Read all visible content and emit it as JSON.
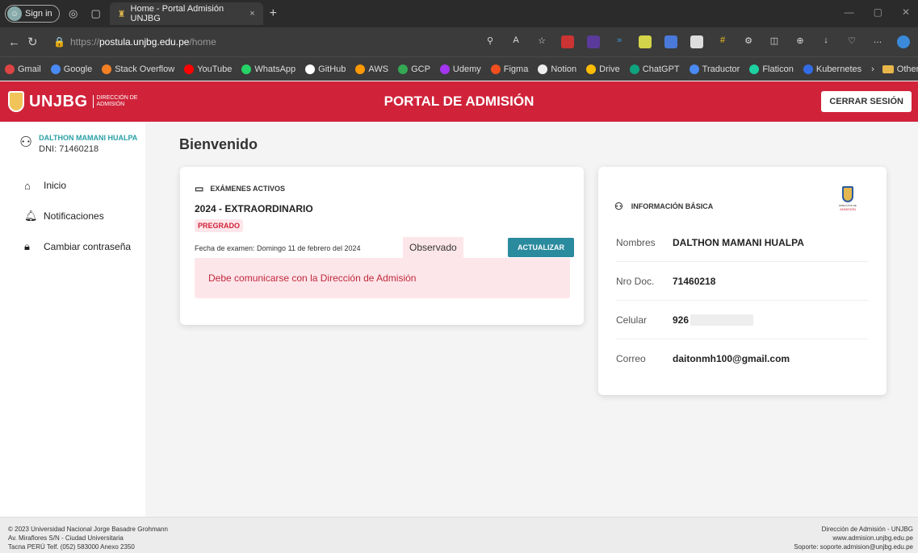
{
  "browser": {
    "signin": "Sign in",
    "tab_title": "Home - Portal Admisión UNJBG",
    "tab_close": "×",
    "new_tab": "+",
    "url_prefix": "https://",
    "url_host": "postula.unjbg.edu.pe",
    "url_path": "/home",
    "bookmarks": [
      "Gmail",
      "Google",
      "Stack Overflow",
      "YouTube",
      "WhatsApp",
      "GitHub",
      "AWS",
      "GCP",
      "Udemy",
      "Figma",
      "Notion",
      "Drive",
      "ChatGPT",
      "Traductor",
      "Flaticon",
      "Kubernetes"
    ],
    "other_favourites": "Other favourites"
  },
  "header": {
    "logo_name": "UNJBG",
    "logo_sub1": "DIRECCIÓN DE",
    "logo_sub2": "ADMISIÓN",
    "title": "PORTAL DE ADMISIÓN",
    "logout": "CERRAR SESIÓN"
  },
  "sidebar": {
    "user_name": "DALTHON MAMANI HUALPA",
    "dni": "DNI: 71460218",
    "items": [
      {
        "label": "Inicio",
        "icon": "home-icon"
      },
      {
        "label": "Notificaciones",
        "icon": "bell-icon"
      },
      {
        "label": "Cambiar contraseña",
        "icon": "lock-icon"
      }
    ]
  },
  "main": {
    "welcome": "Bienvenido",
    "exams": {
      "heading": "EXÁMENES ACTIVOS",
      "exam_name": "2024 - EXTRAORDINARIO",
      "level": "PREGRADO",
      "date": "Fecha de examen: Domingo 11 de febrero del 2024",
      "status": "Observado",
      "update": "ACTUALIZAR",
      "alert": "Debe comunicarse con la Dirección de Admisión"
    },
    "info": {
      "heading": "INFORMACIÓN BÁSICA",
      "logo_line1": "DIRECCIÓN DE",
      "logo_line2": "ADMISIÓN",
      "rows": [
        {
          "key": "Nombres",
          "value": "DALTHON MAMANI HUALPA"
        },
        {
          "key": "Nro Doc.",
          "value": "71460218"
        },
        {
          "key": "Celular",
          "value": "926"
        },
        {
          "key": "Correo",
          "value": "daitonmh100@gmail.com"
        }
      ]
    }
  },
  "footer": {
    "left1": "© 2023 Universidad Nacional Jorge Basadre Grohmann",
    "left2": "Av. Miraflores S/N - Ciudad Universitaria",
    "left3": "Tacna PERÚ Telf. (052) 583000 Anexo 2350",
    "right1": "Dirección de Admisión - UNJBG",
    "right2": "www.admision.unjbg.edu.pe",
    "right3": "Soporte: soporte.admision@unjbg.edu.pe"
  }
}
